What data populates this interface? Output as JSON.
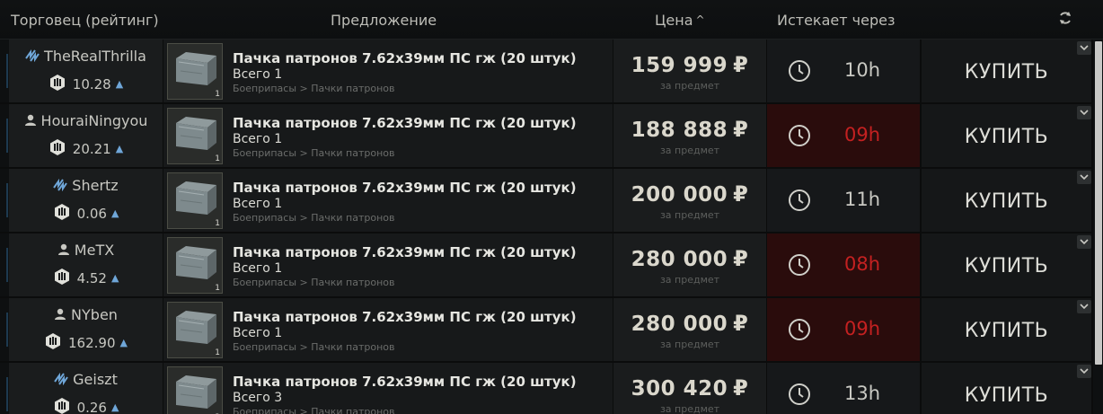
{
  "header": {
    "trader_col": "Торговец (рейтинг)",
    "offer_col": "Предложение",
    "price_col": "Цена",
    "price_sort_caret": "^",
    "expires_col": "Истекает через"
  },
  "offers": [
    {
      "trader": "TheRealThrilla",
      "trader_type": "flea-trader-icon",
      "rating": "10.28",
      "title": "Пачка патронов 7.62x39мм ПС гж (20 штук)",
      "total": "Всего 1",
      "category": "Боеприпасы > Пачки патронов",
      "count": "1",
      "price": "159 999",
      "price_unit": "за предмет",
      "currency": "₽",
      "expires": "10h",
      "urgent": false,
      "buy": "КУПИТЬ"
    },
    {
      "trader": "HouraiNingyou",
      "trader_type": "player-icon",
      "rating": "20.21",
      "title": "Пачка патронов 7.62x39мм ПС гж (20 штук)",
      "total": "Всего 1",
      "category": "Боеприпасы > Пачки патронов",
      "count": "1",
      "price": "188 888",
      "price_unit": "за предмет",
      "currency": "₽",
      "expires": "09h",
      "urgent": true,
      "buy": "КУПИТЬ"
    },
    {
      "trader": "Shertz",
      "trader_type": "flea-trader-icon",
      "rating": "0.06",
      "title": "Пачка патронов 7.62x39мм ПС гж (20 штук)",
      "total": "Всего 1",
      "category": "Боеприпасы > Пачки патронов",
      "count": "1",
      "price": "200 000",
      "price_unit": "за предмет",
      "currency": "₽",
      "expires": "11h",
      "urgent": false,
      "buy": "КУПИТЬ"
    },
    {
      "trader": "MeTX",
      "trader_type": "player-icon",
      "rating": "4.52",
      "title": "Пачка патронов 7.62x39мм ПС гж (20 штук)",
      "total": "Всего 1",
      "category": "Боеприпасы > Пачки патронов",
      "count": "1",
      "price": "280 000",
      "price_unit": "за предмет",
      "currency": "₽",
      "expires": "08h",
      "urgent": true,
      "buy": "КУПИТЬ"
    },
    {
      "trader": "NYben",
      "trader_type": "player-icon",
      "rating": "162.90",
      "title": "Пачка патронов 7.62x39мм ПС гж (20 штук)",
      "total": "Всего 1",
      "category": "Боеприпасы > Пачки патронов",
      "count": "1",
      "price": "280 000",
      "price_unit": "за предмет",
      "currency": "₽",
      "expires": "09h",
      "urgent": true,
      "buy": "КУПИТЬ"
    },
    {
      "trader": "Geiszt",
      "trader_type": "flea-trader-icon",
      "rating": "0.26",
      "title": "Пачка патронов 7.62x39мм ПС гж (20 штук)",
      "total": "Всего 3",
      "category": "Боеприпасы > Пачки патронов",
      "count": "3",
      "price": "300 420",
      "price_unit": "за предмет",
      "currency": "₽",
      "expires": "13h",
      "urgent": false,
      "buy": "КУПИТЬ"
    }
  ]
}
